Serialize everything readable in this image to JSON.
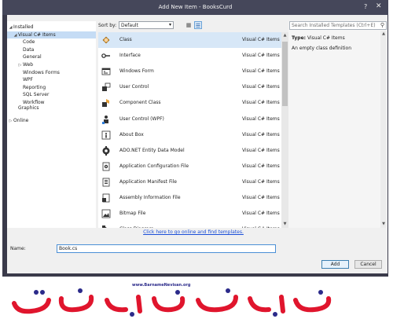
{
  "window": {
    "title": "Add New Item - BooksCurd",
    "help_glyph": "?",
    "close_glyph": "✕"
  },
  "tree": {
    "items": [
      {
        "label": "Installed",
        "arrow": "◢",
        "level": 0
      },
      {
        "label": "Visual C# Items",
        "arrow": "◢",
        "level": 1,
        "selected": true
      },
      {
        "label": "Code",
        "arrow": "",
        "level": 2
      },
      {
        "label": "Data",
        "arrow": "",
        "level": 2
      },
      {
        "label": "General",
        "arrow": "",
        "level": 2
      },
      {
        "label": "Web",
        "arrow": "▷",
        "level": 2
      },
      {
        "label": "Windows Forms",
        "arrow": "",
        "level": 2
      },
      {
        "label": "WPF",
        "arrow": "",
        "level": 2
      },
      {
        "label": "Reporting",
        "arrow": "",
        "level": 2
      },
      {
        "label": "SQL Server",
        "arrow": "",
        "level": 2
      },
      {
        "label": "Workflow",
        "arrow": "",
        "level": 2
      },
      {
        "label": "Graphics",
        "arrow": "",
        "level": 1
      },
      {
        "label": "Online",
        "arrow": "▷",
        "level": 0
      }
    ]
  },
  "toolbar": {
    "sort_label": "Sort by:",
    "sort_value": "Default",
    "sort_chevron": "▾",
    "grid_view_glyph": "▦",
    "list_view_glyph": "☰"
  },
  "templates": {
    "items": [
      {
        "name": "Class",
        "type": "Visual C# Items",
        "icon": "class-icon",
        "selected": true
      },
      {
        "name": "Interface",
        "type": "Visual C# Items",
        "icon": "interface-icon"
      },
      {
        "name": "Windows Form",
        "type": "Visual C# Items",
        "icon": "windows-form-icon"
      },
      {
        "name": "User Control",
        "type": "Visual C# Items",
        "icon": "user-control-icon"
      },
      {
        "name": "Component Class",
        "type": "Visual C# Items",
        "icon": "component-class-icon"
      },
      {
        "name": "User Control (WPF)",
        "type": "Visual C# Items",
        "icon": "wpf-user-control-icon"
      },
      {
        "name": "About Box",
        "type": "Visual C# Items",
        "icon": "about-box-icon"
      },
      {
        "name": "ADO.NET Entity Data Model",
        "type": "Visual C# Items",
        "icon": "entity-data-model-icon"
      },
      {
        "name": "Application Configuration File",
        "type": "Visual C# Items",
        "icon": "config-file-icon"
      },
      {
        "name": "Application Manifest File",
        "type": "Visual C# Items",
        "icon": "manifest-file-icon"
      },
      {
        "name": "Assembly Information File",
        "type": "Visual C# Items",
        "icon": "assembly-info-icon"
      },
      {
        "name": "Bitmap File",
        "type": "Visual C# Items",
        "icon": "bitmap-file-icon"
      },
      {
        "name": "Class Diagram",
        "type": "Visual C# Items",
        "icon": "class-diagram-icon"
      }
    ],
    "online_link": "Click here to go online and find templates."
  },
  "details": {
    "search_placeholder": "Search Installed Templates (Ctrl+E)",
    "search_glyph": "⚲",
    "type_label": "Type:",
    "type_value": "Visual C# Items",
    "description": "An empty class definition"
  },
  "name_field": {
    "label": "Name:",
    "value": "Book.cs"
  },
  "buttons": {
    "add": "Add",
    "cancel": "Cancel"
  },
  "watermark": {
    "url": "www.BarnameNevisan.org"
  },
  "colors": {
    "title_bar": "#45475a",
    "selection": "#c5dcf5",
    "link": "#1a4ed8",
    "logo_red": "#e0152d",
    "logo_blue": "#2b2a8a"
  }
}
